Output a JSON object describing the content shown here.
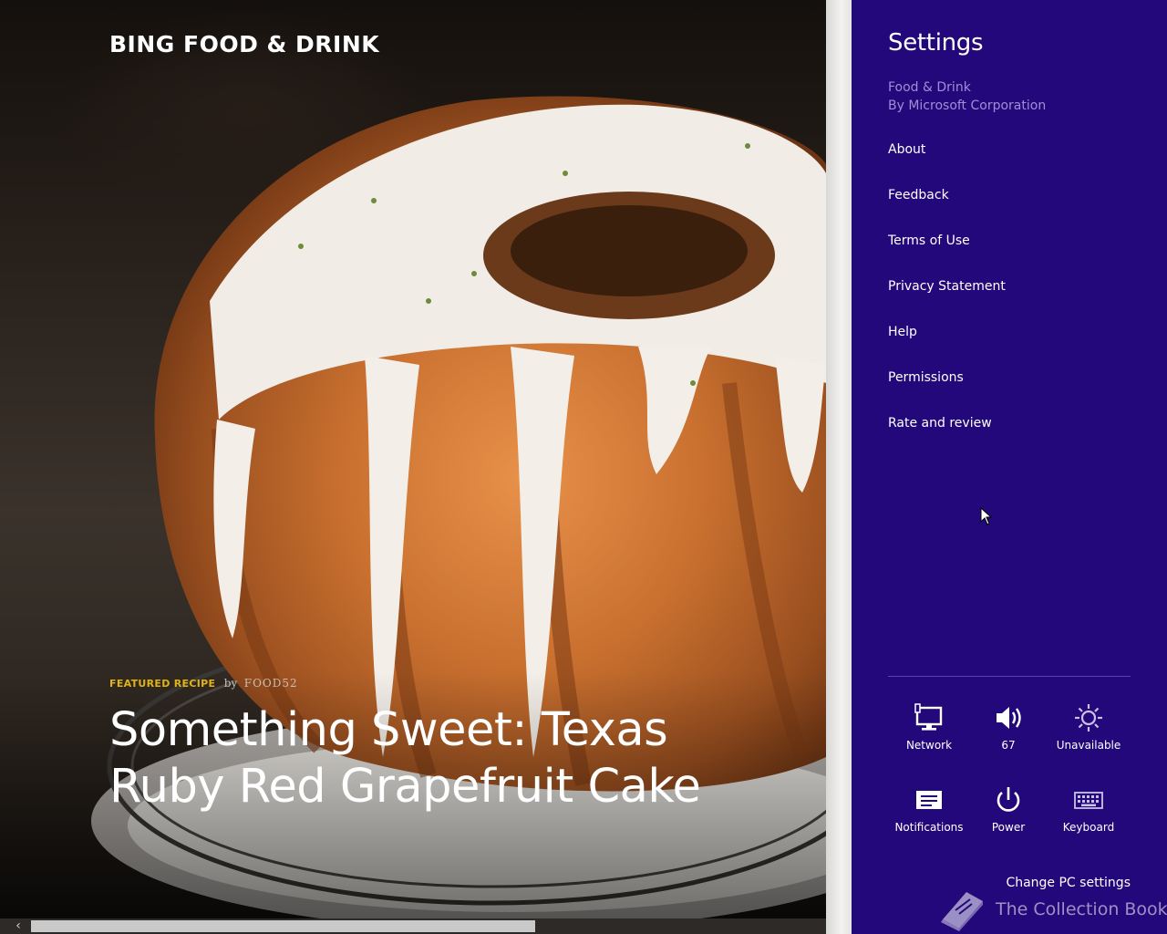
{
  "app": {
    "title": "BING FOOD & DRINK",
    "featured": {
      "tag": "FEATURED RECIPE",
      "by": "by",
      "author": "FOOD52",
      "title": "Something Sweet: Texas Ruby Red Grapefruit Cake"
    }
  },
  "settings": {
    "title": "Settings",
    "app_name": "Food & Drink",
    "publisher": "By Microsoft Corporation",
    "menu": [
      {
        "label": "About"
      },
      {
        "label": "Feedback"
      },
      {
        "label": "Terms of Use"
      },
      {
        "label": "Privacy Statement"
      },
      {
        "label": "Help"
      },
      {
        "label": "Permissions"
      },
      {
        "label": "Rate and review"
      }
    ],
    "tiles": [
      {
        "label": "Network",
        "icon": "network-icon"
      },
      {
        "label": "67",
        "icon": "volume-icon"
      },
      {
        "label": "Unavailable",
        "icon": "brightness-icon"
      },
      {
        "label": "Notifications",
        "icon": "notifications-icon"
      },
      {
        "label": "Power",
        "icon": "power-icon"
      },
      {
        "label": "Keyboard",
        "icon": "keyboard-icon"
      }
    ],
    "change_pc_settings": "Change PC settings"
  },
  "watermark": {
    "text": "The Collection Book",
    "icon": "book-icon"
  },
  "colors": {
    "charm_background": "#22087a",
    "charm_secondary_text": "#9e8fd6",
    "featured_tag": "#e1b316"
  }
}
